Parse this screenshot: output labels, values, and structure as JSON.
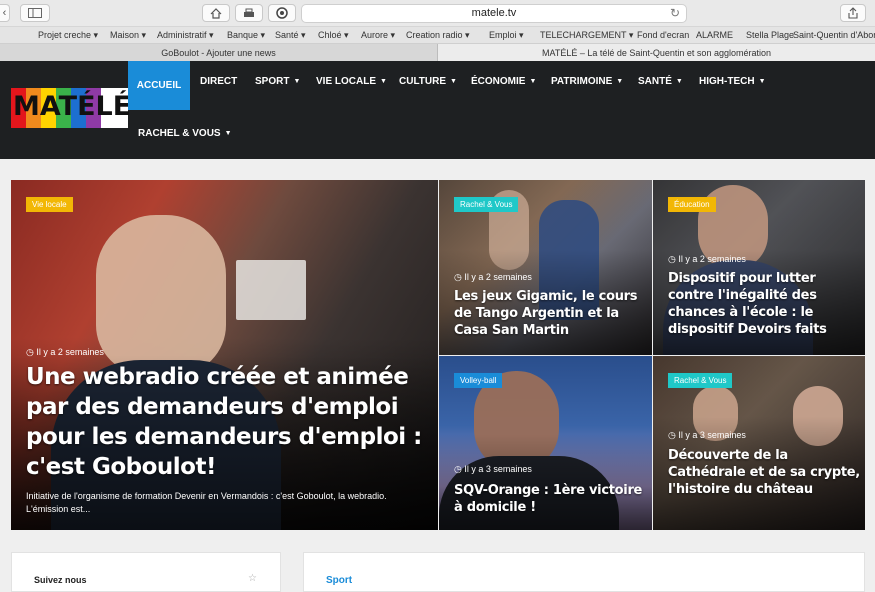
{
  "browser": {
    "url": "matele.tv",
    "bookmarks": [
      "Projet creche ▾",
      "Maison ▾",
      "Administratif ▾",
      "Banque ▾",
      "Santé ▾",
      "Chloé ▾",
      "Aurore ▾",
      "Creation radio ▾",
      "Emploi ▾",
      "TELECHARGEMENT ▾",
      "Fond d'ecran",
      "ALARME",
      "Stella Plage",
      "Saint-Quentin d'Abord ▾"
    ],
    "tabs": [
      "GoBoulot - Ajouter une news",
      "MATÉLÉ – La télé de Saint-Quentin et son agglomération"
    ]
  },
  "site": {
    "logo_text": "MATÉLÉ",
    "nav": [
      "ACCUEIL",
      "DIRECT",
      "SPORT",
      "VIE LOCALE",
      "CULTURE",
      "ÉCONOMIE",
      "PATRIMOINE",
      "SANTÉ",
      "HIGH-TECH",
      "RACHEL & VOUS"
    ]
  },
  "articles": {
    "main": {
      "category": "Vie locale",
      "time": "Il y a 2 semaines",
      "title": "Une webradio créée et animée par des demandeurs d'emploi pour les demandeurs d'emploi : c'est Goboulot!",
      "excerpt": "Initiative de l'organisme de formation Devenir en Vermandois : c'est Goboulot, la webradio. L'émission est..."
    },
    "a1": {
      "category": "Rachel & Vous",
      "time": "Il y a 2 semaines",
      "title": "Les jeux Gigamic, le cours de Tango Argentin et la Casa San Martin"
    },
    "a2": {
      "category": "Éducation",
      "time": "Il y a 2 semaines",
      "title": "Dispositif pour lutter contre l'inégalité des chances à l'école : le dispositif Devoirs faits"
    },
    "a3": {
      "category": "Volley-ball",
      "time": "Il y a 3 semaines",
      "title": "SQV-Orange : 1ère victoire à domicile !"
    },
    "a4": {
      "category": "Rachel & Vous",
      "time": "Il y a 3 semaines",
      "title": "Découverte de la Cathédrale et de sa crypte, l'histoire du château"
    }
  },
  "bottom": {
    "follow_title": "Suivez nous",
    "sport_title": "Sport"
  },
  "colors": {
    "nav_bg": "#1e2022",
    "accent": "#1a8cd8",
    "badge_yellow": "#f2b705",
    "badge_teal": "#1fc8c8",
    "badge_blue": "#1a8cd8"
  }
}
